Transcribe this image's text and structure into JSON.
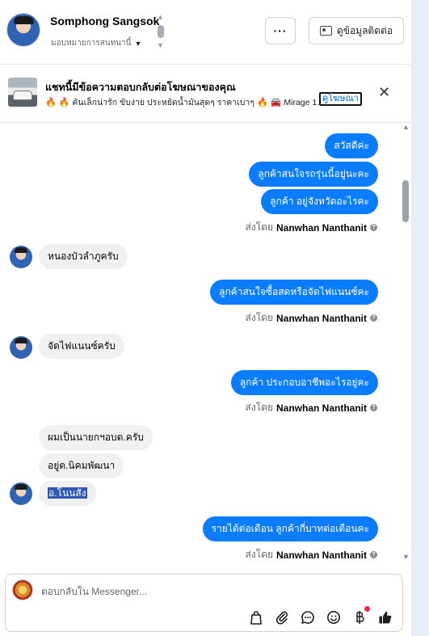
{
  "header": {
    "contact_name": "Somphong Sangsok",
    "assign_label": "มอบหมายการสนทนานี้",
    "more_label": "···",
    "view_contact_label": "ดูข้อมูลติดต่อ"
  },
  "ad_banner": {
    "title": "แชทนี้มีข้อความตอบกลับต่อโฆษณาของคุณ",
    "subtitle_text": "คันเล็กน่ารัก ขับง่าย ประหยัดน้ำมันสุดๆ ราคาเบาๆ",
    "subtitle_car": "Mirage 1....",
    "link_label": "ดูโฆษณา",
    "close_label": "✕"
  },
  "messages": {
    "m1": "สวัสดีค่ะ",
    "m2": "ลูกค้าสนใจรถรุ่นนี้อยู่นะคะ",
    "m3": "ลูกค้า อยู่จังหวัดอะไรคะ",
    "m4": "หนองบัวลำภูครับ",
    "m5": "ลูกค้าสนใจซื้อสดหรือจัดไฟแนนซ์คะ",
    "m6": "จัดไฟแนนซ์ครับ",
    "m7": "ลูกค้า ประกอบอาชีพอะไรอยู่คะ",
    "m8": "ผมเป็นนายกฯอบต.ครับ",
    "m9": "อยู่ต.นิคมพัฒนา",
    "m10": "อ.โนนสัง",
    "m11": "รายได้ต่อเดือน  ลูกค้ากี่บาทต่อเดือนคะ"
  },
  "sent_by": {
    "prefix": "ส่งโดย",
    "name": "Nanwhan Nanthanit",
    "info": "?"
  },
  "composer": {
    "placeholder": "ตอบกลับใน Messenger..."
  },
  "icons": {
    "bag": "shopping-bag-icon",
    "attach": "paperclip-icon",
    "saved_reply": "saved-reply-icon",
    "emoji": "emoji-icon",
    "baht": "baht-icon",
    "like": "thumbs-up-icon"
  },
  "colors": {
    "outgoing_bubble": "#0a7cff",
    "incoming_bubble": "#f0f0f0",
    "link": "#0064d1",
    "notification_dot": "#f02849"
  }
}
